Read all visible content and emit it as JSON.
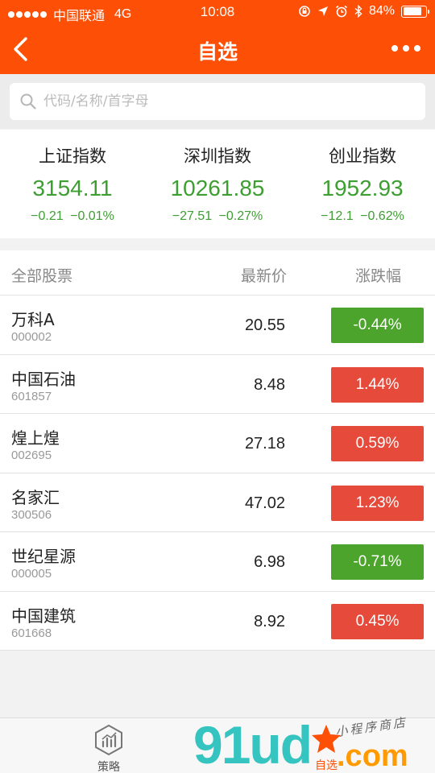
{
  "status_bar": {
    "carrier": "中国联通",
    "network": "4G",
    "time": "10:08",
    "battery": "84%",
    "battery_level": 0.84
  },
  "nav": {
    "title": "自选",
    "back_icon": "chevron-left-icon",
    "more_icon": "more-dots-icon"
  },
  "search": {
    "placeholder": "代码/名称/首字母",
    "value": ""
  },
  "indices": [
    {
      "name": "上证指数",
      "value": "3154.11",
      "change": "−0.21",
      "change_pct": "−0.01%"
    },
    {
      "name": "深圳指数",
      "value": "10261.85",
      "change": "−27.51",
      "change_pct": "−0.27%"
    },
    {
      "name": "创业指数",
      "value": "1952.93",
      "change": "−12.1",
      "change_pct": "−0.62%"
    }
  ],
  "list": {
    "headers": {
      "name": "全部股票",
      "price": "最新价",
      "change": "涨跌幅"
    },
    "rows": [
      {
        "name": "万科A",
        "code": "000002",
        "price": "20.55",
        "change": "-0.44%",
        "direction": "down"
      },
      {
        "name": "中国石油",
        "code": "601857",
        "price": "8.48",
        "change": "1.44%",
        "direction": "up"
      },
      {
        "name": "煌上煌",
        "code": "002695",
        "price": "27.18",
        "change": "0.59%",
        "direction": "up"
      },
      {
        "name": "名家汇",
        "code": "300506",
        "price": "47.02",
        "change": "1.23%",
        "direction": "up"
      },
      {
        "name": "世纪星源",
        "code": "000005",
        "price": "6.98",
        "change": "-0.71%",
        "direction": "down"
      },
      {
        "name": "中国建筑",
        "code": "601668",
        "price": "8.92",
        "change": "0.45%",
        "direction": "up"
      }
    ]
  },
  "tabbar": {
    "strategy_label": "策略",
    "watchlist_label": "自选"
  },
  "watermark": {
    "main": "91ud",
    "suffix": ".com",
    "subtitle": "小程序商店"
  },
  "colors": {
    "brand": "#fe4f06",
    "up": "#e64a3b",
    "down": "#4ca42c",
    "index_green": "#3d9e31",
    "watermark_teal": "#35c4bf",
    "watermark_orange": "#ff9a00"
  }
}
